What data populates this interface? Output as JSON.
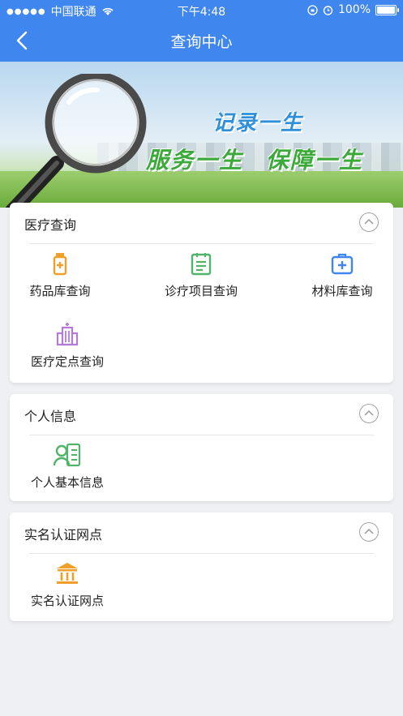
{
  "statusbar": {
    "carrier": "中国联通",
    "time": "下午4:48",
    "battery": "100%"
  },
  "navbar": {
    "title": "查询中心"
  },
  "banner": {
    "slogan_line1": "记录一生",
    "slogan_line2": "服务一生 保障一生"
  },
  "sections": [
    {
      "title": "医疗查询",
      "items": [
        {
          "label": "药品库查询",
          "icon": "medicine-bottle-icon"
        },
        {
          "label": "诊疗项目查询",
          "icon": "notepad-icon"
        },
        {
          "label": "材料库查询",
          "icon": "medical-kit-icon"
        },
        {
          "label": "医疗定点查询",
          "icon": "hospital-building-icon"
        }
      ]
    },
    {
      "title": "个人信息",
      "items": [
        {
          "label": "个人基本信息",
          "icon": "id-card-icon"
        }
      ]
    },
    {
      "title": "实名认证网点",
      "items": [
        {
          "label": "实名认证网点",
          "icon": "bank-building-icon"
        }
      ]
    }
  ],
  "colors": {
    "brand": "#3f86ee",
    "orange": "#f0a02a",
    "green": "#52b36a",
    "blue": "#3f86ee",
    "purple": "#b47ad8"
  }
}
